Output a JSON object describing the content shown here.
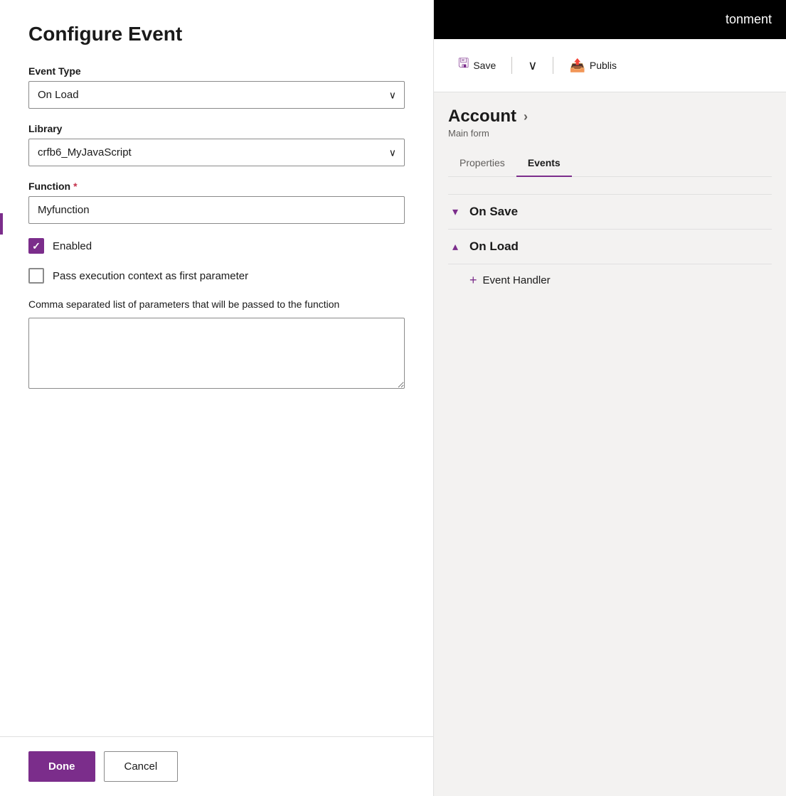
{
  "dialog": {
    "title": "Configure Event",
    "event_type_label": "Event Type",
    "event_type_value": "On Load",
    "library_label": "Library",
    "library_value": "crfb6_MyJavaScript",
    "function_label": "Function",
    "function_required": "*",
    "function_value": "Myfunction",
    "enabled_label": "Enabled",
    "enabled_checked": true,
    "pass_context_label": "Pass execution context as first parameter",
    "pass_context_checked": false,
    "params_label": "Comma separated list of parameters that will be passed to the function",
    "params_value": "",
    "done_label": "Done",
    "cancel_label": "Cancel"
  },
  "topbar": {
    "title": "tonment"
  },
  "toolbar": {
    "save_label": "Save",
    "publish_label": "Publis"
  },
  "sidebar": {
    "account_title": "Account",
    "account_subtitle": "Main form"
  },
  "tabs": [
    {
      "label": "Properties",
      "active": false
    },
    {
      "label": "Events",
      "active": true
    }
  ],
  "events": [
    {
      "name": "On Save",
      "expanded": false,
      "chevron": "▾"
    },
    {
      "name": "On Load",
      "expanded": true,
      "chevron": "▴"
    }
  ],
  "add_handler_label": "Event Handler",
  "icons": {
    "save": "💾",
    "publish": "📤",
    "chevron_down": "∨",
    "chevron_right": "›",
    "plus": "+"
  }
}
